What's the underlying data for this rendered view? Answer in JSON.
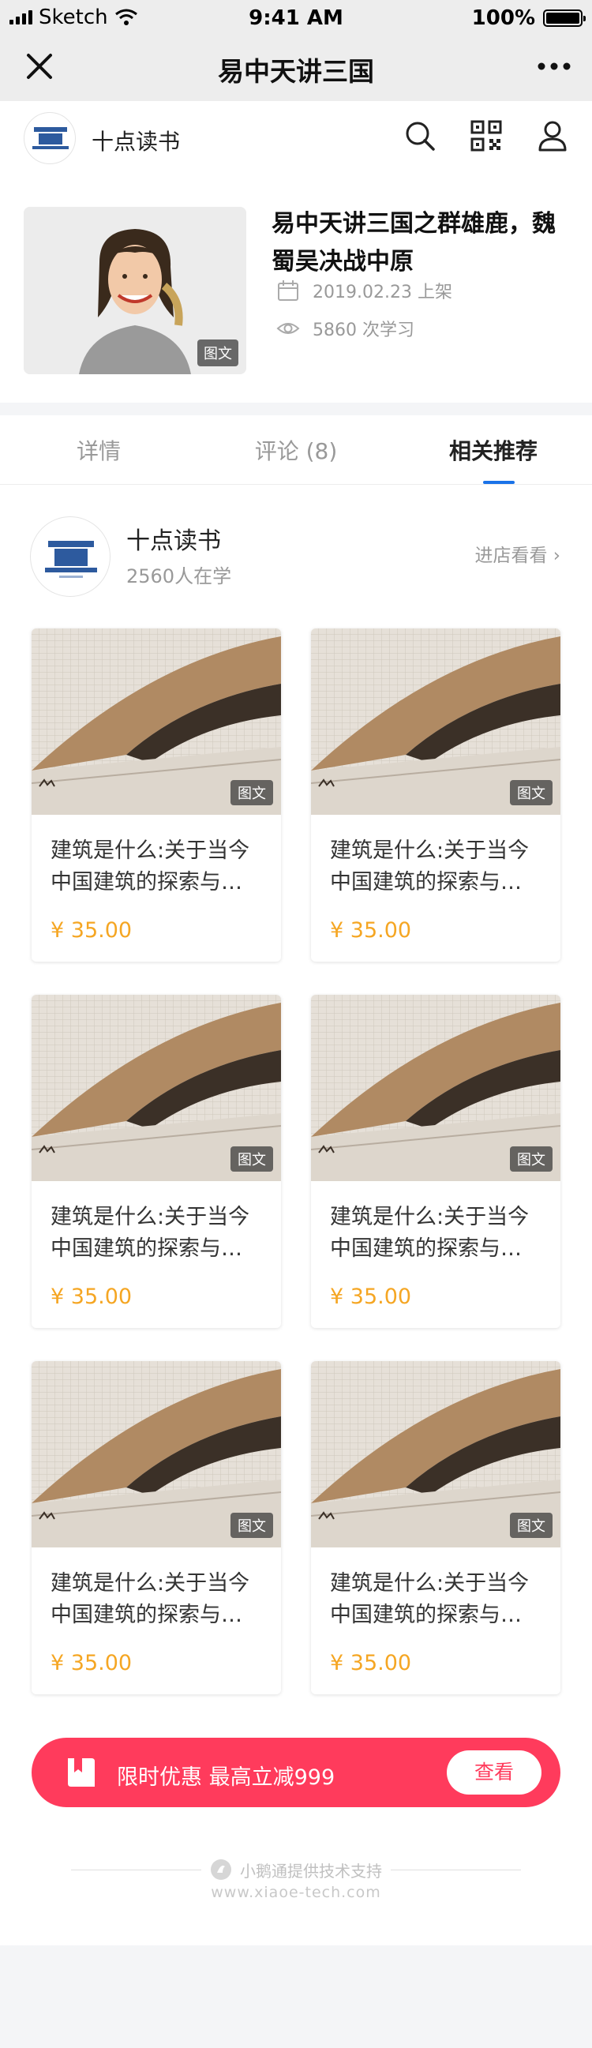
{
  "status_bar": {
    "carrier": "Sketch",
    "time": "9:41 AM",
    "battery": "100%",
    "battery_level": 1.0
  },
  "nav": {
    "title": "易中天讲三国"
  },
  "shop": {
    "name": "十点读书"
  },
  "article": {
    "title": "易中天讲三国之群雄鹿，魏蜀吴决战中原",
    "cover_badge": "图文",
    "date": "2019.02.23 上架",
    "views": "5860 次学习"
  },
  "tabs": [
    {
      "label": "详情"
    },
    {
      "label": "评论 (8)"
    },
    {
      "label": "相关推荐"
    }
  ],
  "store": {
    "name": "十点读书",
    "count": "2560人在学",
    "link_label": "进店看看 ›"
  },
  "products": [
    {
      "title": "建筑是什么:关于当今中国建筑的探索与…",
      "price": "¥ 35.00",
      "badge": "图文"
    },
    {
      "title": "建筑是什么:关于当今中国建筑的探索与…",
      "price": "¥ 35.00",
      "badge": "图文"
    },
    {
      "title": "建筑是什么:关于当今中国建筑的探索与…",
      "price": "¥ 35.00",
      "badge": "图文"
    },
    {
      "title": "建筑是什么:关于当今中国建筑的探索与…",
      "price": "¥ 35.00",
      "badge": "图文"
    },
    {
      "title": "建筑是什么:关于当今中国建筑的探索与…",
      "price": "¥ 35.00",
      "badge": "图文"
    },
    {
      "title": "建筑是什么:关于当今中国建筑的探索与…",
      "price": "¥ 35.00",
      "badge": "图文"
    }
  ],
  "promo": {
    "text": "限时优惠 最高立减999",
    "button": "查看"
  },
  "footer": {
    "text": "小鹅通提供技术支持",
    "url": "www.xiaoe-tech.com"
  },
  "colors": {
    "accent": "#1a73e8",
    "promo": "#ff3b5c",
    "price": "#f5a623"
  },
  "icons": {
    "nav": [
      "close-icon",
      "more-icon"
    ],
    "shop": [
      "search-icon",
      "qrcode-icon",
      "user-icon"
    ],
    "meta": [
      "calendar-icon",
      "eye-icon"
    ],
    "promo": "book-icon",
    "footer": "logo-icon"
  }
}
